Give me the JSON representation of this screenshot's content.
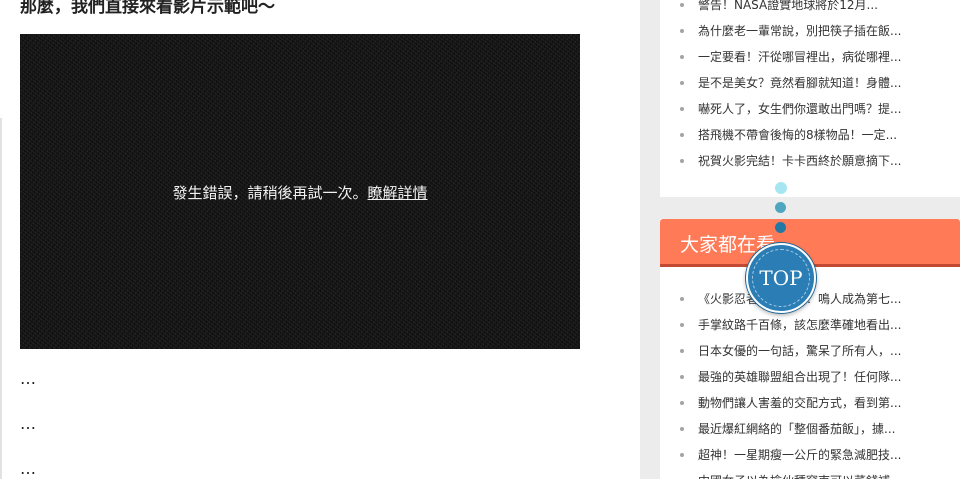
{
  "article": {
    "intro": "那麼，我們直接來看影片示範吧～",
    "video_error": "發生錯誤，請稍後再試一次。",
    "video_link": "瞭解詳情",
    "ellipsis": [
      "…",
      "…",
      "…"
    ]
  },
  "sidebar": {
    "list1": [
      "警告！NASA證實地球將於12月...",
      "為什麼老一輩常說，別把筷子插在飯...",
      "一定要看！汗從哪冒裡出，病從哪裡...",
      "是不是美女？竟然看腳就知道！身體...",
      "嚇死人了，女生們你還敢出門嗎？提...",
      "搭飛機不帶會後悔的8樣物品！一定...",
      "祝賀火影完結！卡卡西終於願意摘下..."
    ],
    "panel2_title": "大家都在看",
    "list2": [
      "《火影忍者》大結局！鳴人成為第七...",
      "手掌紋路千百條，該怎麼準確地看出...",
      "日本女優的一句話，驚呆了所有人，...",
      "最強的英雄聯盟組合出現了！任何隊...",
      "動物們讓人害羞的交配方式，看到第...",
      "最近爆紅網絡的「整個番茄飯」，據...",
      "超神！一星期瘦一公斤的緊急減肥技...",
      "中國女子以為撿伙種窩東可以菜錢補..."
    ]
  },
  "back_to_top": {
    "label": "TOP"
  },
  "colors": {
    "panel_header": "#ff7a57",
    "panel_header_border": "#c24a33",
    "top_button": "#2a7db5"
  }
}
